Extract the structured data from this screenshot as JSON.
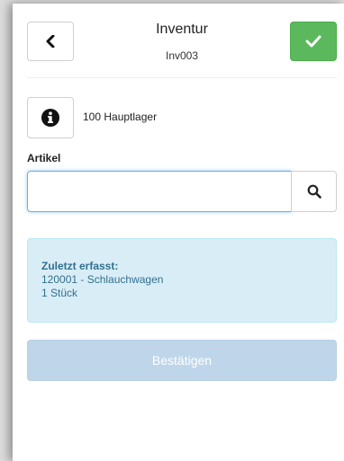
{
  "header": {
    "title": "Inventur",
    "subtitle": "Inv003",
    "back_icon": "chevron-left-icon",
    "confirm_icon": "check-icon",
    "confirm_color": "#5cb85c"
  },
  "location": {
    "info_icon": "info-circle-icon",
    "text": "100 Hauptlager"
  },
  "article": {
    "label": "Artikel",
    "value": "",
    "placeholder": "",
    "search_icon": "search-icon"
  },
  "last_recorded": {
    "title": "Zuletzt erfasst:",
    "item": "120001 - Schlauchwagen",
    "quantity": "1 Stück",
    "color": "#31708f",
    "background": "#d9edf7"
  },
  "confirm_button": {
    "label": "Bestätigen",
    "state": "disabled"
  }
}
